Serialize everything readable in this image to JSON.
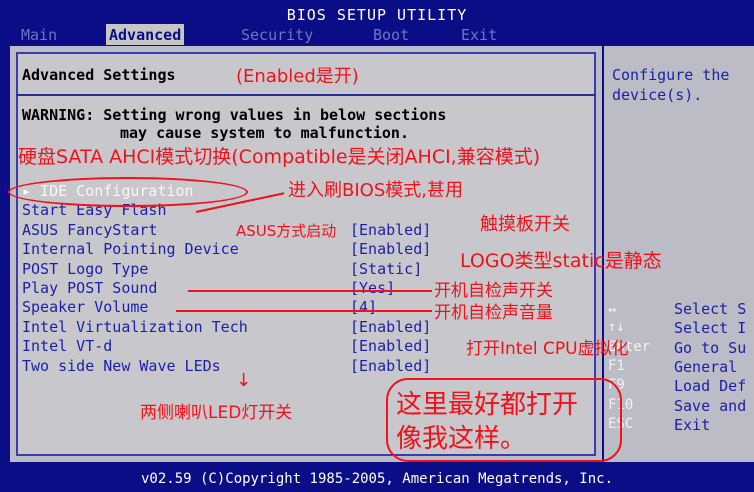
{
  "title": "BIOS SETUP UTILITY",
  "tabs": [
    {
      "label": "Main"
    },
    {
      "label": "Advanced"
    },
    {
      "label": "Security"
    },
    {
      "label": "Boot"
    },
    {
      "label": "Exit"
    }
  ],
  "section_title": "Advanced Settings",
  "warning_line1": "WARNING: Setting wrong values in below sections",
  "warning_line2": "may cause system to malfunction.",
  "menu": [
    {
      "label": "▸ IDE Configuration",
      "value": ""
    },
    {
      "label": "Start Easy Flash",
      "value": ""
    },
    {
      "label": "ASUS FancyStart",
      "value": "[Enabled]"
    },
    {
      "label": "Internal Pointing Device",
      "value": "[Enabled]"
    },
    {
      "label": "POST Logo Type",
      "value": "[Static]"
    },
    {
      "label": "Play POST Sound",
      "value": "[Yes]"
    },
    {
      "label": "Speaker Volume",
      "value": "[4]"
    },
    {
      "label": "Intel Virtualization Tech",
      "value": "[Enabled]"
    },
    {
      "label": "Intel VT-d",
      "value": "[Enabled]"
    },
    {
      "label": "Two side New Wave LEDs",
      "value": "[Enabled]"
    }
  ],
  "help_line1": "Configure the",
  "help_line2": "device(s).",
  "keys": [
    {
      "key": "↔",
      "desc": "Select S"
    },
    {
      "key": "↑↓",
      "desc": "Select I"
    },
    {
      "key": "Enter",
      "desc": "Go to Su"
    },
    {
      "key": "F1",
      "desc": "General"
    },
    {
      "key": "F9",
      "desc": "Load Def"
    },
    {
      "key": "F10",
      "desc": "Save and"
    },
    {
      "key": "ESC",
      "desc": "Exit"
    }
  ],
  "footer": "v02.59 (C)Copyright 1985-2005, American Megatrends, Inc.",
  "annotations": {
    "enabled_is_on": "(Enabled是开)",
    "ahci": "硬盘SATA AHCI模式切换(Compatible是关闭AHCI,兼容模式)",
    "flash": "进入刷BIOS模式,甚用",
    "fancystart": "ASUS方式启动",
    "touchpad": "触摸板开关",
    "logo": "LOGO类型static是静态",
    "post_sound": "开机自检声开关",
    "post_volume": "开机自检声音量",
    "vt": "打开Intel CPU虚拟化",
    "leds": "两侧喇叭LED灯开关",
    "tip_line1": "这里最好都打开",
    "tip_line2": "像我这样。",
    "arrow": "↓"
  },
  "colors": {
    "bios_blue": "#0b0d86",
    "panel_gray": "#c8c8cc",
    "annotation_red": "#f2101a"
  }
}
